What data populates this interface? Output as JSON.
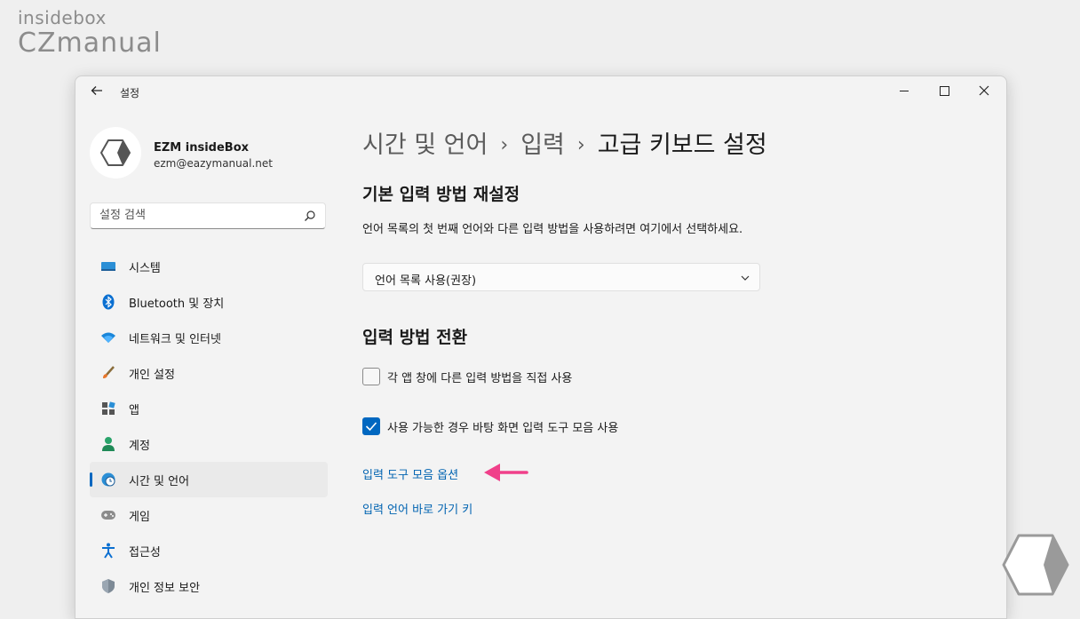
{
  "watermark": {
    "line1": "insidebox",
    "line2": "CZmanual"
  },
  "window": {
    "title": "설정",
    "controls": {
      "minimize": "minimize",
      "maximize": "maximize",
      "close": "close"
    }
  },
  "profile": {
    "name": "EZM insideBox",
    "email": "ezm@eazymanual.net"
  },
  "search": {
    "placeholder": "설정 검색"
  },
  "sidebar": {
    "items": [
      {
        "label": "시스템",
        "icon": "monitor-icon",
        "active": false
      },
      {
        "label": "Bluetooth 및 장치",
        "icon": "bluetooth-icon",
        "active": false
      },
      {
        "label": "네트워크 및 인터넷",
        "icon": "wifi-icon",
        "active": false
      },
      {
        "label": "개인 설정",
        "icon": "brush-icon",
        "active": false
      },
      {
        "label": "앱",
        "icon": "apps-icon",
        "active": false
      },
      {
        "label": "계정",
        "icon": "person-icon",
        "active": false
      },
      {
        "label": "시간 및 언어",
        "icon": "globe-clock-icon",
        "active": true
      },
      {
        "label": "게임",
        "icon": "gamepad-icon",
        "active": false
      },
      {
        "label": "접근성",
        "icon": "accessibility-icon",
        "active": false
      },
      {
        "label": "개인 정보 보안",
        "icon": "shield-icon",
        "active": false
      }
    ]
  },
  "breadcrumb": {
    "part1": "시간 및 언어",
    "sep": "›",
    "part2": "입력",
    "current": "고급 키보드 설정"
  },
  "section1": {
    "title": "기본 입력 방법 재설정",
    "description": "언어 목록의 첫 번째 언어와 다른 입력 방법을 사용하려면 여기에서 선택하세요.",
    "dropdown_value": "언어 목록 사용(권장)"
  },
  "section2": {
    "title": "입력 방법 전환",
    "checkbox1": {
      "label": "각 앱 창에 다른 입력 방법을 직접 사용",
      "checked": false
    },
    "checkbox2": {
      "label": "사용 가능한 경우 바탕 화면 입력 도구 모음 사용",
      "checked": true
    }
  },
  "links": {
    "toolbar_options": "입력 도구 모음 옵션",
    "hotkeys": "입력 언어 바로 가기 키"
  },
  "colors": {
    "accent": "#0067c0",
    "link": "#0063b1",
    "annotation_arrow": "#f0408a"
  }
}
